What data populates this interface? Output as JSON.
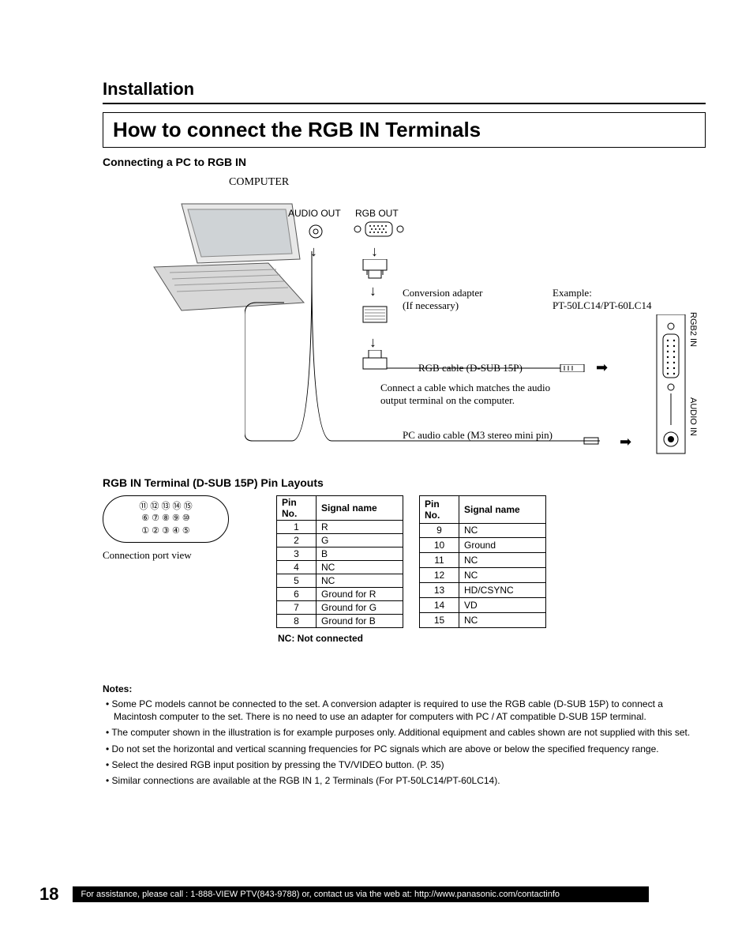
{
  "section_title": "Installation",
  "main_title": "How to connect the RGB IN Terminals",
  "subhead_connecting": "Connecting a PC to RGB IN",
  "diagram": {
    "computer": "COMPUTER",
    "audio_out": "AUDIO OUT",
    "rgb_out": "RGB OUT",
    "conversion_adapter": "Conversion adapter",
    "if_necessary": "(If necessary)",
    "example": "Example:",
    "example_models": "PT-50LC14/PT-60LC14",
    "rgb_cable": "RGB cable (D-SUB 15P)",
    "connect_cable": "Connect a cable which matches the audio output terminal on the computer.",
    "pc_audio_cable": "PC audio cable (M3 stereo mini pin)",
    "rgb2_in": "RGB2 IN",
    "audio_in": "AUDIO IN"
  },
  "subhead_pin_layouts": "RGB IN Terminal (D-SUB 15P) Pin Layouts",
  "port_caption": "Connection port view",
  "pin_header_no": "Pin No.",
  "pin_header_name": "Signal name",
  "pin_table_left": [
    {
      "no": "1",
      "name": "R"
    },
    {
      "no": "2",
      "name": "G"
    },
    {
      "no": "3",
      "name": "B"
    },
    {
      "no": "4",
      "name": "NC"
    },
    {
      "no": "5",
      "name": "NC"
    },
    {
      "no": "6",
      "name": "Ground for R"
    },
    {
      "no": "7",
      "name": "Ground for G"
    },
    {
      "no": "8",
      "name": "Ground for B"
    }
  ],
  "pin_table_right": [
    {
      "no": "9",
      "name": "NC"
    },
    {
      "no": "10",
      "name": "Ground"
    },
    {
      "no": "11",
      "name": "NC"
    },
    {
      "no": "12",
      "name": "NC"
    },
    {
      "no": "13",
      "name": "HD/CSYNC"
    },
    {
      "no": "14",
      "name": "VD"
    },
    {
      "no": "15",
      "name": "NC"
    }
  ],
  "nc_note": "NC: Not connected",
  "notes_title": "Notes:",
  "notes": [
    "Some PC models cannot be connected to the set. A conversion adapter is required to use the RGB cable (D-SUB 15P) to connect a Macintosh computer to the set. There is no need to use an adapter for computers with PC / AT compatible D-SUB 15P terminal.",
    "The computer shown in the illustration is for example purposes only. Additional equipment and cables shown are not supplied with this set.",
    "Do not set the horizontal and vertical scanning frequencies for PC signals which are above or below the specified frequency range.",
    "Select the desired RGB input position by pressing the TV/VIDEO button. (P. 35)",
    "Similar connections are available at the RGB IN 1, 2 Terminals (For PT-50LC14/PT-60LC14)."
  ],
  "page_number": "18",
  "footer_text": "For assistance, please call : 1-888-VIEW PTV(843-9788) or, contact us via the web at: http://www.panasonic.com/contactinfo",
  "dsub_pins": {
    "row1": "⑪ ⑫ ⑬ ⑭ ⑮",
    "row2": "⑥ ⑦ ⑧ ⑨ ⑩",
    "row3": "① ② ③ ④ ⑤"
  }
}
